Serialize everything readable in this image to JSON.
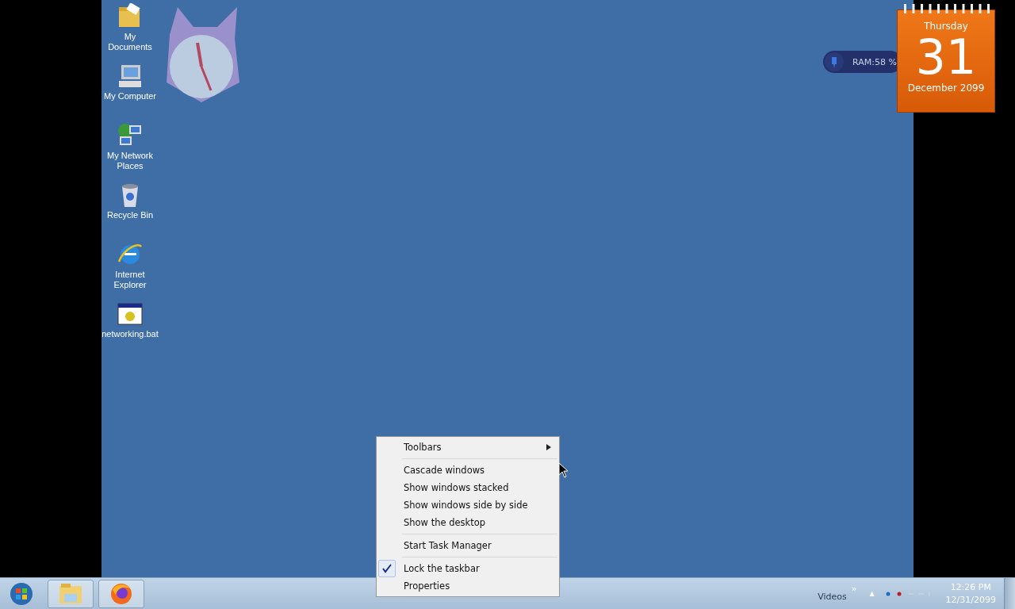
{
  "desktop_icons": [
    {
      "kind": "documents",
      "label": "My Documents"
    },
    {
      "kind": "computer",
      "label": "My Computer"
    },
    {
      "kind": "network",
      "label": "My Network Places"
    },
    {
      "kind": "recycle",
      "label": "Recycle Bin"
    },
    {
      "kind": "browser",
      "label": "Internet Explorer"
    },
    {
      "kind": "batch",
      "label": "networking.bat"
    }
  ],
  "ram_gadget": {
    "reading": "RAM:58 %"
  },
  "calendar_gadget": {
    "weekday": "Thursday",
    "day": "31",
    "month_year": "December 2099"
  },
  "context_menu": [
    {
      "kind": "item",
      "label": "Toolbars",
      "submenu": true,
      "checked": false
    },
    {
      "kind": "separator"
    },
    {
      "kind": "item",
      "label": "Cascade windows",
      "submenu": false,
      "checked": false
    },
    {
      "kind": "item",
      "label": "Show windows stacked",
      "submenu": false,
      "checked": false
    },
    {
      "kind": "item",
      "label": "Show windows side by side",
      "submenu": false,
      "checked": false
    },
    {
      "kind": "item",
      "label": "Show the desktop",
      "submenu": false,
      "checked": false
    },
    {
      "kind": "separator"
    },
    {
      "kind": "item",
      "label": "Start Task Manager",
      "submenu": false,
      "checked": false
    },
    {
      "kind": "separator"
    },
    {
      "kind": "item",
      "label": "Lock the taskbar",
      "submenu": false,
      "checked": true
    },
    {
      "kind": "item",
      "label": "Properties",
      "submenu": false,
      "checked": false
    }
  ],
  "taskbar": {
    "pinned": [
      {
        "kind": "folder"
      },
      {
        "kind": "firefox"
      }
    ],
    "toolbar_label": "Videos",
    "chevron": "»",
    "tray_arrow": "▲",
    "time": "12:26 PM",
    "date": "12/31/2099"
  }
}
